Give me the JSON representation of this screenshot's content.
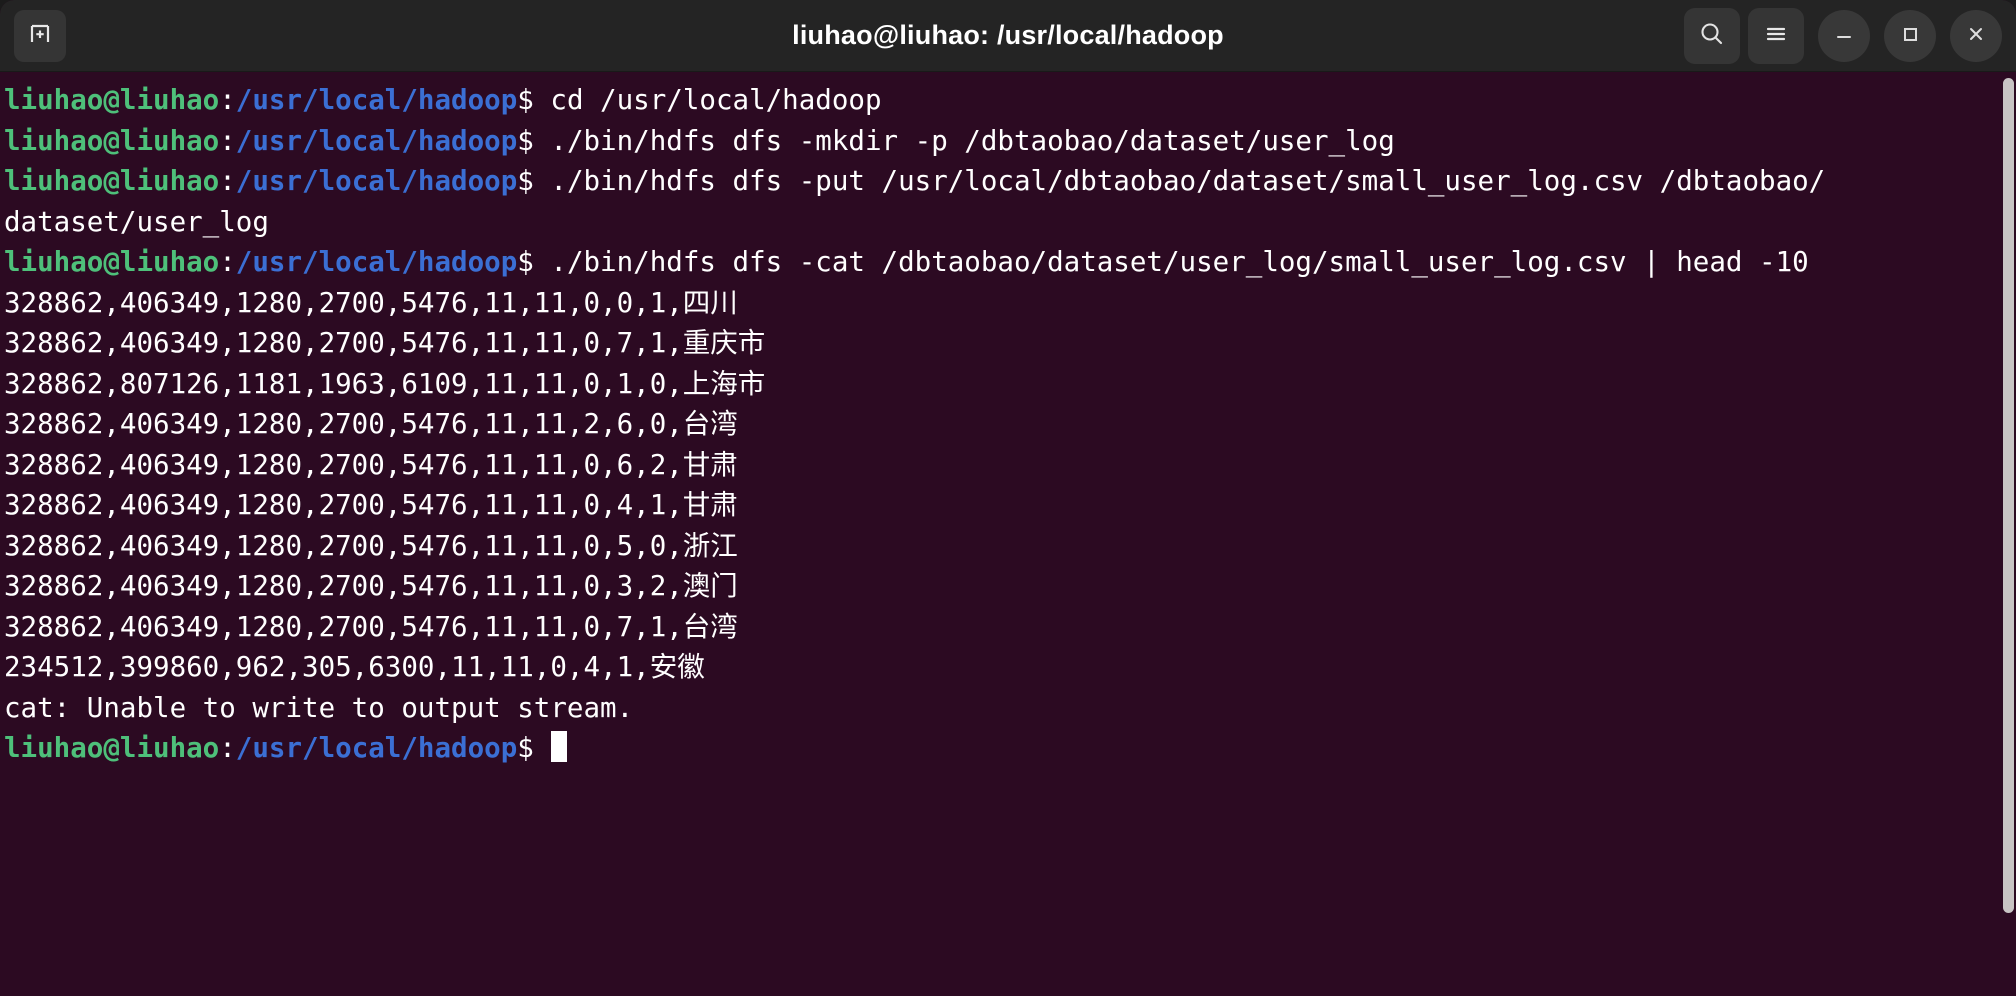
{
  "window": {
    "title": "liuhao@liuhao: /usr/local/hadoop",
    "bg_color": "#2c0a22",
    "titlebar_color": "#242424",
    "prompt_user_color": "#4ec07a",
    "prompt_path_color": "#3b6fd4",
    "text_color": "#ffffff"
  },
  "titlebar": {
    "new_tab_icon": "new-tab-icon",
    "search_icon": "search-icon",
    "menu_icon": "hamburger-menu-icon",
    "minimize_icon": "minimize-icon",
    "maximize_icon": "maximize-icon",
    "close_icon": "close-icon"
  },
  "prompt": {
    "user": "liuhao@liuhao",
    "colon": ":",
    "path": "/usr/local/hadoop",
    "dollar": "$ "
  },
  "terminal": {
    "lines": [
      {
        "type": "prompt",
        "command": "cd /usr/local/hadoop"
      },
      {
        "type": "prompt",
        "command": "./bin/hdfs dfs -mkdir -p /dbtaobao/dataset/user_log"
      },
      {
        "type": "prompt",
        "command": "./bin/hdfs dfs -put /usr/local/dbtaobao/dataset/small_user_log.csv /dbtaobao/"
      },
      {
        "type": "output",
        "text": "dataset/user_log"
      },
      {
        "type": "prompt",
        "command": "./bin/hdfs dfs -cat /dbtaobao/dataset/user_log/small_user_log.csv | head -10"
      },
      {
        "type": "output",
        "text": "328862,406349,1280,2700,5476,11,11,0,0,1,四川"
      },
      {
        "type": "output",
        "text": "328862,406349,1280,2700,5476,11,11,0,7,1,重庆市"
      },
      {
        "type": "output",
        "text": "328862,807126,1181,1963,6109,11,11,0,1,0,上海市"
      },
      {
        "type": "output",
        "text": "328862,406349,1280,2700,5476,11,11,2,6,0,台湾"
      },
      {
        "type": "output",
        "text": "328862,406349,1280,2700,5476,11,11,0,6,2,甘肃"
      },
      {
        "type": "output",
        "text": "328862,406349,1280,2700,5476,11,11,0,4,1,甘肃"
      },
      {
        "type": "output",
        "text": "328862,406349,1280,2700,5476,11,11,0,5,0,浙江"
      },
      {
        "type": "output",
        "text": "328862,406349,1280,2700,5476,11,11,0,3,2,澳门"
      },
      {
        "type": "output",
        "text": "328862,406349,1280,2700,5476,11,11,0,7,1,台湾"
      },
      {
        "type": "output",
        "text": "234512,399860,962,305,6300,11,11,0,4,1,安徽"
      },
      {
        "type": "output",
        "text": "cat: Unable to write to output stream."
      },
      {
        "type": "prompt_cursor",
        "command": ""
      }
    ]
  },
  "scrollbar": {
    "name": "vertical-scrollbar"
  }
}
